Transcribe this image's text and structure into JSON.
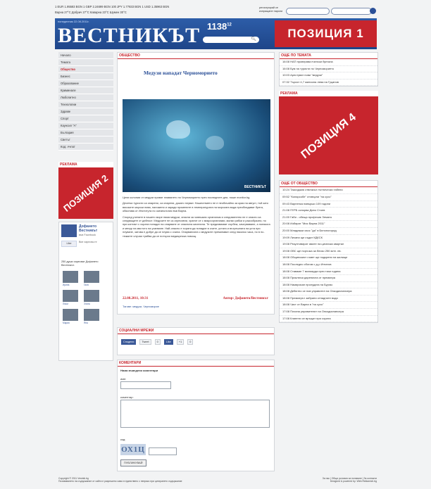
{
  "topbar": {
    "rates": "1 EUR 1.95583 BGN    1 GBP 2.24699 BGN    100 JPY 1.77833 BGN    1 USD 1.35963 BGN",
    "weather": "Варна  27°C   Добрич  27°C   Каварна  23°C   Шумен  30°C",
    "register": "регистрирай се изпращане пароли"
  },
  "header": {
    "date": "понеделник 22.08.2011г.",
    "logo": "ВЕСТНИКЪТ",
    "number": "1138",
    "number_sup": "12",
    "search_icon": "search-icon",
    "banner": "ПОЗИЦИЯ 1"
  },
  "nav": [
    "Начало",
    "Темата",
    "Общество",
    "Бизнес",
    "Образование",
    "Криминале",
    "Любопитно",
    "Технологии",
    "Здраве",
    "Спорт",
    "Каунсил \"А\"",
    "България",
    "Светът",
    "Код: Ачпот"
  ],
  "left": {
    "ads_title": "РЕКЛАМА",
    "banner": "ПОЗИЦИЯ 2",
    "fb": {
      "name": "Дофането Вестникът",
      "sub": "във Facebook",
      "like": "Like",
      "desc": "Вие харесва-те",
      "count": "250 души харесват Дофането Вестникът.",
      "faces": [
        "Ирина",
        "Галя",
        "Люси",
        "Злата",
        "Мария",
        "Яна"
      ]
    }
  },
  "article": {
    "section": "ОБЩЕСТВО",
    "title": "Медузи нападат Черноморието",
    "watermark": "ВЕСТНИКЪТ",
    "paragraphs": [
      "Цели колонии от медузи правят плаването по Черноморието през последните дни, пише monitor.bg.",
      "Десетки туристи са опарени, са опарени, докато плуват. Нашествието не е необичайно за края на август, тъй като високите морски нива, наложени и заради промените в температурата на морската вода преобладават брега, обяснява от Института по океанология във Варна.",
      "Според учените в нашето море няма медузи, опасни за човешкия организъм и следователно не е опасно за следващите от дейност. Медузите не са агресивни, хранят се с микроорганизми, малки рибки и ракообразни, но при контакт с хората попадат на опарване от опасната киселина. Те предизвикват сърбеж, зачервяване, а понякога и мехур на мястото на ухапване. Най-опасно е хората да попадне в очите, устата и вътрешната на уста при плуване, затова е добре да се плува с очила. Опарванията с медузите преминават след няколко часа, но в по-тежките случаи трябва да се потърси медицинска помощ."
    ],
    "date": "22.08.2011, 10:31",
    "author": "Автор: Дофането/Вестникът",
    "tags": "Тагове: медузи, Черноморие"
  },
  "social": {
    "title": "СОЦИАЛНИ МРЕЖИ",
    "buttons": [
      "Сподели",
      "Tweet",
      "0",
      "Like",
      "+1",
      "0"
    ]
  },
  "comments": {
    "title": "КОМЕНТАРИ",
    "subtitle": "Няма въведени коментари",
    "name_label": "име:",
    "comment_label": "коментар:",
    "code_label": "код:",
    "captcha": "ОХ1Ц",
    "submit": "ПУБЛИКУВАЙ"
  },
  "right": {
    "theme_title": "ОЩЕ ПО ТЕМАТА",
    "theme_items": [
      "16:08 НАП проверява пчелски бунгала",
      "16:08 Бум на туристи по Черноморието",
      "10:03 Арестуват нови \"медузи\"",
      "07:32 Търсят 4,7 милиона левa на Гуцанов"
    ],
    "ads_title": "РЕКЛАМА",
    "banner": "ПОЗИЦИЯ 4",
    "more_title": "ОЩЕ ОТ ОБЩЕСТВО",
    "more_items": [
      "10:24 Таксиджия отвлякъл пътнически табели",
      "09:52 \"Копарсобе\" отхвърли \"на сухо\"",
      "09:43 Варненка навърши 109 години",
      "21:08 ГЕРБ оспорва Дино Стоев",
      "21:00 Габи - обеща професия Земята",
      "20:08 Избират \"Мис Варна 2011\"",
      "20:00 Младежки хаос \"да\" в Белоногорад",
      "19:09 Личани ще съдят КДКСК",
      "19:08 Рекултивират ямите на цигански квартал",
      "19:08 ОВС ще поръчка за близо 250 млн. лв.",
      "18:08 Общинският съвет ще подкрепи на жилище",
      "18:08 Последно сбогом с д-р Игнатов",
      "18:08 Ставаме 7 милиарда през тази година",
      "18:08 Приключи даренията от премиера",
      "18:08 Намирисан пролудата на Бургас",
      "18:08 Дебютно се нов управител на Онкодиспансера",
      "18:08 Премиерът забрани отпадните води",
      "18:08 Чист от Варна в \"на сухо\"",
      "17:08 Почина управителят на Онкодиспансера",
      "17:08 Клиенти се връщат при сората"
    ]
  },
  "footer": {
    "left1": "Copyright © 2011 Vestnik.bg",
    "left2": "Позоваването на съдържание от сайта е разрешено само в единствено с непряко при цитирането съдържание",
    "right1": "За нас  |  Общи условия за ползване  |  За контакти",
    "right2": "Designed & powered by: Web.Reklamich.bg"
  },
  "colors": {
    "accent": "#c7252d",
    "header": "#2d5da8",
    "link": "#2a4f97"
  }
}
